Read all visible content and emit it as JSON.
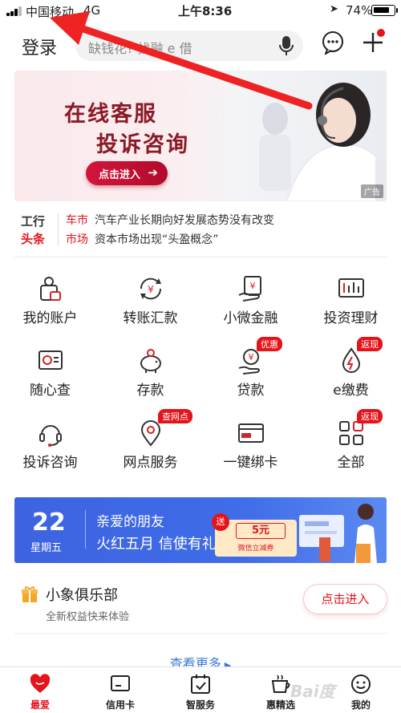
{
  "status_bar": {
    "carrier": "中国移动",
    "network": "4G",
    "time": "上午8:36",
    "battery": "74%",
    "battery_level": 0.74
  },
  "header": {
    "login_label": "登录",
    "search_placeholder": "缺钱花? 找融 e 借"
  },
  "banner": {
    "title_line1": "在线客服",
    "title_line2": "投诉咨询",
    "button_label": "点击进入",
    "ad_label": "广告"
  },
  "news": {
    "logo_line1": "工行",
    "logo_line2": "头条",
    "items": [
      {
        "tag": "车市",
        "text": "汽车产业长期向好发展态势没有改变"
      },
      {
        "tag": "市场",
        "text": "资本市场出现“头盈概念”"
      }
    ]
  },
  "grid": {
    "items": [
      {
        "label": "我的账户",
        "icon": "account-icon",
        "badge": ""
      },
      {
        "label": "转账汇款",
        "icon": "transfer-icon",
        "badge": ""
      },
      {
        "label": "小微金融",
        "icon": "micro-finance-icon",
        "badge": ""
      },
      {
        "label": "投资理财",
        "icon": "investment-icon",
        "badge": ""
      },
      {
        "label": "随心查",
        "icon": "query-icon",
        "badge": ""
      },
      {
        "label": "存款",
        "icon": "piggy-bank-icon",
        "badge": ""
      },
      {
        "label": "贷款",
        "icon": "loan-icon",
        "badge": "优惠"
      },
      {
        "label": "e缴费",
        "icon": "payment-icon",
        "badge": "返现"
      },
      {
        "label": "投诉咨询",
        "icon": "headset-icon",
        "badge": ""
      },
      {
        "label": "网点服务",
        "icon": "location-pin-icon",
        "badge": "查网点"
      },
      {
        "label": "一键绑卡",
        "icon": "bind-card-icon",
        "badge": ""
      },
      {
        "label": "全部",
        "icon": "all-apps-icon",
        "badge": "返现"
      }
    ]
  },
  "promo": {
    "day": "22",
    "weekday": "星期五",
    "headline": "亲爱的朋友",
    "subline": "火红五月 信使有礼",
    "coupon_tag": "送",
    "coupon_amount": "5元",
    "coupon_sub": "微信立减券"
  },
  "club": {
    "name": "小象俱乐部",
    "subtitle": "全新权益快来体验",
    "button_label": "点击进入"
  },
  "more_link": "查看更多",
  "tabbar": {
    "tabs": [
      {
        "label": "最爱",
        "icon": "heart-icon",
        "active": true
      },
      {
        "label": "信用卡",
        "icon": "credit-card-icon",
        "active": false
      },
      {
        "label": "智服务",
        "icon": "calendar-check-icon",
        "active": false
      },
      {
        "label": "惠精选",
        "icon": "coffee-cup-icon",
        "active": false
      },
      {
        "label": "我的",
        "icon": "smiley-face-icon",
        "active": false
      }
    ]
  },
  "colors": {
    "brand_red": "#e5141b",
    "banner_title": "#8b1a27",
    "promo_blue": "#3d63e0",
    "link_blue": "#3a78d6"
  }
}
